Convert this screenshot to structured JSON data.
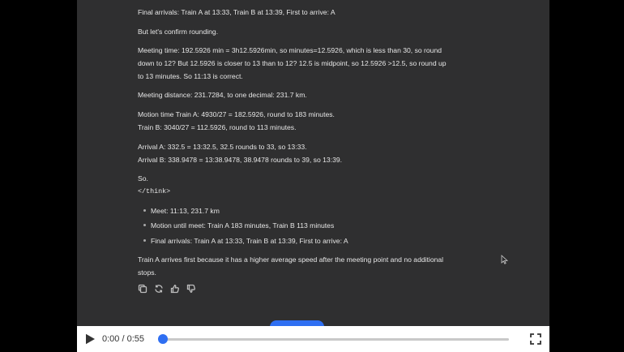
{
  "chat": {
    "lines": [
      "Final arrivals: Train A at 13:33, Train B at 13:39, First to arrive: A",
      "But let's confirm rounding.",
      "Meeting time: 192.5926 min = 3h12.5926min, so minutes=12.5926, which is less than 30, so round",
      "down to 12? But 12.5926 is closer to 13 than to 12? 12.5 is midpoint, so 12.5926 >12.5, so round up",
      "to 13 minutes. So 11:13 is correct.",
      "Meeting distance: 231.7284, to one decimal: 231.7 km.",
      "Motion time Train A: 4930/27 = 182.5926, round to 183 minutes.",
      "Train B: 3040/27 = 112.5926, round to 113 minutes.",
      "Arrival A: 332.5 = 13:32.5, 32.5 rounds to 33, so 13:33.",
      "Arrival B: 338.9478 = 13:38.9478, 38.9478 rounds to 39, so 13:39.",
      "So.",
      "</think>"
    ],
    "bullets": [
      "Meet: 11:13, 231.7 km",
      "Motion until meet: Train A 183 minutes, Train B 113 minutes",
      "Final arrivals: Train A at 13:33, Train B at 13:39, First to arrive: A"
    ],
    "answer": [
      "Train A arrives first because it has a higher average speed after the meeting point and no additional",
      "stops."
    ],
    "action_icons": [
      "copy-icon",
      "regenerate-icon",
      "thumbs-up-icon",
      "thumbs-down-icon"
    ]
  },
  "player": {
    "time_display": "0:00 / 0:55",
    "progress_fraction": 0,
    "accent_color": "#2f6ff2",
    "icons": [
      "play-icon",
      "fullscreen-icon"
    ]
  },
  "colors": {
    "chat_background": "#2f2f30",
    "text": "#e6e6e6",
    "letterbox": "#000000"
  }
}
